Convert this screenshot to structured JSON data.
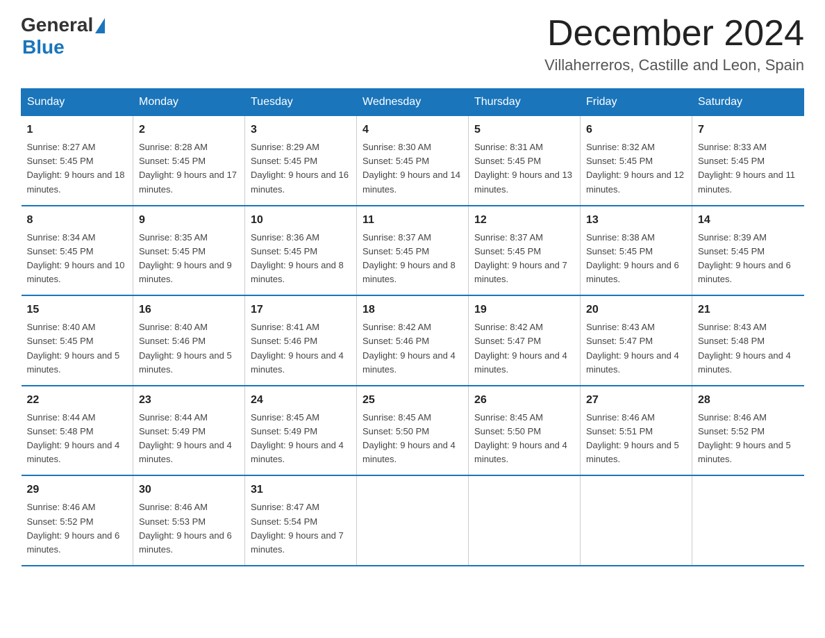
{
  "logo": {
    "general": "General",
    "blue": "Blue"
  },
  "header": {
    "month_year": "December 2024",
    "location": "Villaherreros, Castille and Leon, Spain"
  },
  "weekdays": [
    "Sunday",
    "Monday",
    "Tuesday",
    "Wednesday",
    "Thursday",
    "Friday",
    "Saturday"
  ],
  "weeks": [
    [
      {
        "day": "1",
        "sunrise": "8:27 AM",
        "sunset": "5:45 PM",
        "daylight": "9 hours and 18 minutes."
      },
      {
        "day": "2",
        "sunrise": "8:28 AM",
        "sunset": "5:45 PM",
        "daylight": "9 hours and 17 minutes."
      },
      {
        "day": "3",
        "sunrise": "8:29 AM",
        "sunset": "5:45 PM",
        "daylight": "9 hours and 16 minutes."
      },
      {
        "day": "4",
        "sunrise": "8:30 AM",
        "sunset": "5:45 PM",
        "daylight": "9 hours and 14 minutes."
      },
      {
        "day": "5",
        "sunrise": "8:31 AM",
        "sunset": "5:45 PM",
        "daylight": "9 hours and 13 minutes."
      },
      {
        "day": "6",
        "sunrise": "8:32 AM",
        "sunset": "5:45 PM",
        "daylight": "9 hours and 12 minutes."
      },
      {
        "day": "7",
        "sunrise": "8:33 AM",
        "sunset": "5:45 PM",
        "daylight": "9 hours and 11 minutes."
      }
    ],
    [
      {
        "day": "8",
        "sunrise": "8:34 AM",
        "sunset": "5:45 PM",
        "daylight": "9 hours and 10 minutes."
      },
      {
        "day": "9",
        "sunrise": "8:35 AM",
        "sunset": "5:45 PM",
        "daylight": "9 hours and 9 minutes."
      },
      {
        "day": "10",
        "sunrise": "8:36 AM",
        "sunset": "5:45 PM",
        "daylight": "9 hours and 8 minutes."
      },
      {
        "day": "11",
        "sunrise": "8:37 AM",
        "sunset": "5:45 PM",
        "daylight": "9 hours and 8 minutes."
      },
      {
        "day": "12",
        "sunrise": "8:37 AM",
        "sunset": "5:45 PM",
        "daylight": "9 hours and 7 minutes."
      },
      {
        "day": "13",
        "sunrise": "8:38 AM",
        "sunset": "5:45 PM",
        "daylight": "9 hours and 6 minutes."
      },
      {
        "day": "14",
        "sunrise": "8:39 AM",
        "sunset": "5:45 PM",
        "daylight": "9 hours and 6 minutes."
      }
    ],
    [
      {
        "day": "15",
        "sunrise": "8:40 AM",
        "sunset": "5:45 PM",
        "daylight": "9 hours and 5 minutes."
      },
      {
        "day": "16",
        "sunrise": "8:40 AM",
        "sunset": "5:46 PM",
        "daylight": "9 hours and 5 minutes."
      },
      {
        "day": "17",
        "sunrise": "8:41 AM",
        "sunset": "5:46 PM",
        "daylight": "9 hours and 4 minutes."
      },
      {
        "day": "18",
        "sunrise": "8:42 AM",
        "sunset": "5:46 PM",
        "daylight": "9 hours and 4 minutes."
      },
      {
        "day": "19",
        "sunrise": "8:42 AM",
        "sunset": "5:47 PM",
        "daylight": "9 hours and 4 minutes."
      },
      {
        "day": "20",
        "sunrise": "8:43 AM",
        "sunset": "5:47 PM",
        "daylight": "9 hours and 4 minutes."
      },
      {
        "day": "21",
        "sunrise": "8:43 AM",
        "sunset": "5:48 PM",
        "daylight": "9 hours and 4 minutes."
      }
    ],
    [
      {
        "day": "22",
        "sunrise": "8:44 AM",
        "sunset": "5:48 PM",
        "daylight": "9 hours and 4 minutes."
      },
      {
        "day": "23",
        "sunrise": "8:44 AM",
        "sunset": "5:49 PM",
        "daylight": "9 hours and 4 minutes."
      },
      {
        "day": "24",
        "sunrise": "8:45 AM",
        "sunset": "5:49 PM",
        "daylight": "9 hours and 4 minutes."
      },
      {
        "day": "25",
        "sunrise": "8:45 AM",
        "sunset": "5:50 PM",
        "daylight": "9 hours and 4 minutes."
      },
      {
        "day": "26",
        "sunrise": "8:45 AM",
        "sunset": "5:50 PM",
        "daylight": "9 hours and 4 minutes."
      },
      {
        "day": "27",
        "sunrise": "8:46 AM",
        "sunset": "5:51 PM",
        "daylight": "9 hours and 5 minutes."
      },
      {
        "day": "28",
        "sunrise": "8:46 AM",
        "sunset": "5:52 PM",
        "daylight": "9 hours and 5 minutes."
      }
    ],
    [
      {
        "day": "29",
        "sunrise": "8:46 AM",
        "sunset": "5:52 PM",
        "daylight": "9 hours and 6 minutes."
      },
      {
        "day": "30",
        "sunrise": "8:46 AM",
        "sunset": "5:53 PM",
        "daylight": "9 hours and 6 minutes."
      },
      {
        "day": "31",
        "sunrise": "8:47 AM",
        "sunset": "5:54 PM",
        "daylight": "9 hours and 7 minutes."
      },
      null,
      null,
      null,
      null
    ]
  ]
}
